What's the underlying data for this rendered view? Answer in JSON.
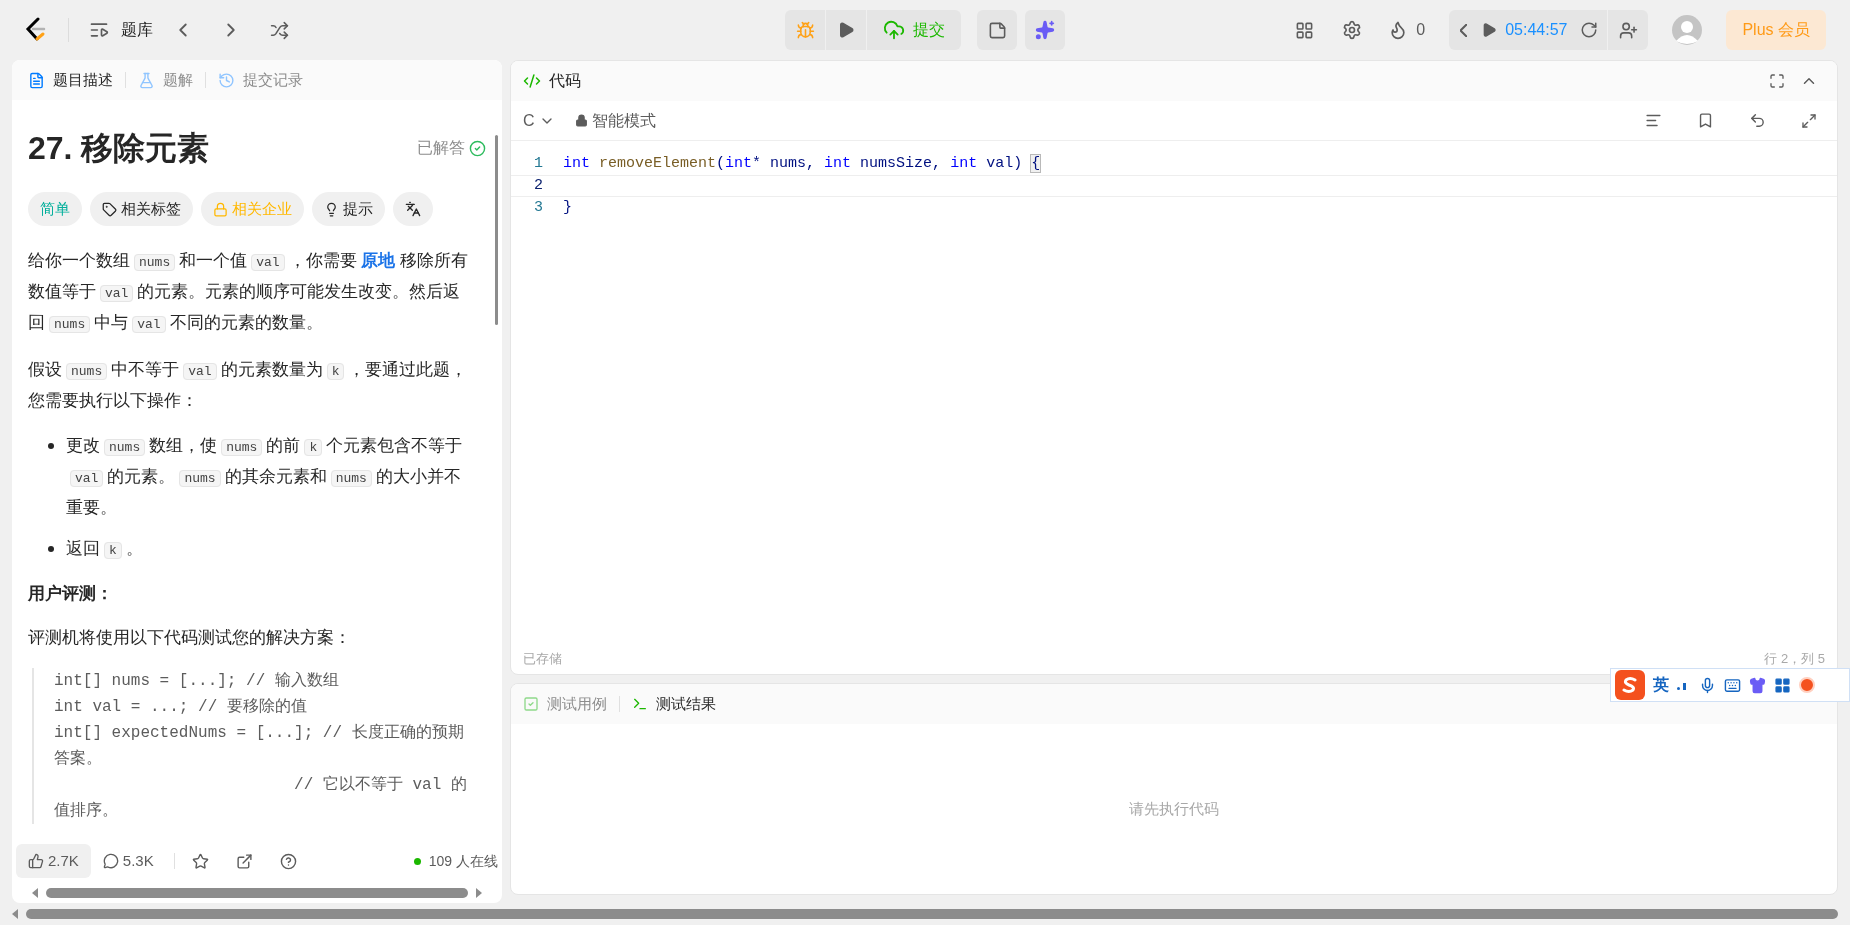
{
  "top_bar": {
    "library_label": "题库",
    "submit_label": "提交",
    "streak_count": "0",
    "timer": "05:44:57",
    "plus_label": "Plus 会员"
  },
  "description_panel": {
    "tabs": [
      {
        "label": "题目描述",
        "selected": true
      },
      {
        "label": "题解",
        "selected": false
      },
      {
        "label": "提交记录",
        "selected": false
      }
    ],
    "title": "27. 移除元素",
    "status": "已解答",
    "tags": [
      {
        "kind": "difficulty",
        "label": "简单"
      },
      {
        "kind": "topics",
        "label": "相关标签"
      },
      {
        "kind": "companies",
        "label": "相关企业"
      },
      {
        "kind": "hint",
        "label": "提示"
      },
      {
        "kind": "font"
      }
    ],
    "blocks": [
      {
        "kind": "paragraph",
        "segments": [
          {
            "kind": "text",
            "text": "给你一个数组"
          },
          {
            "kind": "code",
            "text": "nums"
          },
          {
            "kind": "text",
            "text": "和一个值"
          },
          {
            "kind": "code",
            "text": "val"
          },
          {
            "kind": "text",
            "text": "，你需要 "
          },
          {
            "kind": "emphasis",
            "text": "原地"
          },
          {
            "kind": "text",
            "text": " 移除所有数值等于"
          },
          {
            "kind": "code",
            "text": "val"
          },
          {
            "kind": "text",
            "text": "的元素。元素的顺序可能发生改变。然后返回"
          },
          {
            "kind": "code",
            "text": "nums"
          },
          {
            "kind": "text",
            "text": "中与"
          },
          {
            "kind": "code",
            "text": "val"
          },
          {
            "kind": "text",
            "text": "不同的元素的数量。"
          }
        ]
      },
      {
        "kind": "paragraph",
        "segments": [
          {
            "kind": "text",
            "text": "假设"
          },
          {
            "kind": "code",
            "text": "nums"
          },
          {
            "kind": "text",
            "text": "中不等于"
          },
          {
            "kind": "code",
            "text": "val"
          },
          {
            "kind": "text",
            "text": "的元素数量为"
          },
          {
            "kind": "code",
            "text": "k"
          },
          {
            "kind": "text",
            "text": "，要通过此题，您需要执行以下操作："
          }
        ]
      },
      {
        "kind": "bullets",
        "items": [
          [
            {
              "kind": "text",
              "text": "更改"
            },
            {
              "kind": "code",
              "text": "nums"
            },
            {
              "kind": "text",
              "text": "数组，使"
            },
            {
              "kind": "code",
              "text": "nums"
            },
            {
              "kind": "text",
              "text": "的前"
            },
            {
              "kind": "code",
              "text": "k"
            },
            {
              "kind": "text",
              "text": "个元素包含不等于"
            },
            {
              "kind": "code",
              "text": "val"
            },
            {
              "kind": "text",
              "text": "的元素。"
            },
            {
              "kind": "code",
              "text": "nums"
            },
            {
              "kind": "text",
              "text": "的其余元素和"
            },
            {
              "kind": "code",
              "text": "nums"
            },
            {
              "kind": "text",
              "text": "的大小并不重要。"
            }
          ],
          [
            {
              "kind": "text",
              "text": "返回"
            },
            {
              "kind": "code",
              "text": "k"
            },
            {
              "kind": "text",
              "text": "。"
            }
          ]
        ]
      },
      {
        "kind": "heading",
        "text": "用户评测："
      },
      {
        "kind": "paragraph",
        "segments": [
          {
            "kind": "text",
            "text": "评测机将使用以下代码测试您的解决方案："
          }
        ]
      },
      {
        "kind": "code",
        "lines": [
          "int[] nums = [...]; // 输入数组",
          "int val = ...; // 要移除的值",
          "int[] expectedNums = [...]; // 长度正确的预期答案。",
          "                         // 它以不等于 val 的值排序。"
        ]
      }
    ],
    "footer": {
      "likes": "2.7K",
      "comments": "5.3K",
      "online": "109 人在线"
    }
  },
  "code_panel": {
    "title": "代码",
    "language": "C",
    "mode": "智能模式",
    "lines": [
      {
        "number": "1",
        "current": false,
        "tokens": [
          {
            "kind": "keyword",
            "text": "int"
          },
          {
            "kind": "function",
            "text": " removeElement"
          },
          {
            "kind": "plain",
            "text": "("
          },
          {
            "kind": "keyword",
            "text": "int"
          },
          {
            "kind": "plain",
            "text": "* nums, "
          },
          {
            "kind": "keyword",
            "text": "int"
          },
          {
            "kind": "plain",
            "text": " numsSize, "
          },
          {
            "kind": "keyword",
            "text": "int"
          },
          {
            "kind": "plain",
            "text": " val) "
          },
          {
            "kind": "bracket",
            "text": "{"
          }
        ]
      },
      {
        "number": "2",
        "current": true
      },
      {
        "number": "3",
        "current": false,
        "tokens": [
          {
            "kind": "plain",
            "text": "}"
          }
        ]
      }
    ],
    "saved": "已存储",
    "cursor": "行 2，列 5"
  },
  "test_panel": {
    "tabs": [
      {
        "label": "测试用例",
        "selected": false
      },
      {
        "label": "测试结果",
        "selected": true
      }
    ],
    "message": "请先执行代码"
  },
  "ime_toolbar": {
    "mode": "英"
  }
}
